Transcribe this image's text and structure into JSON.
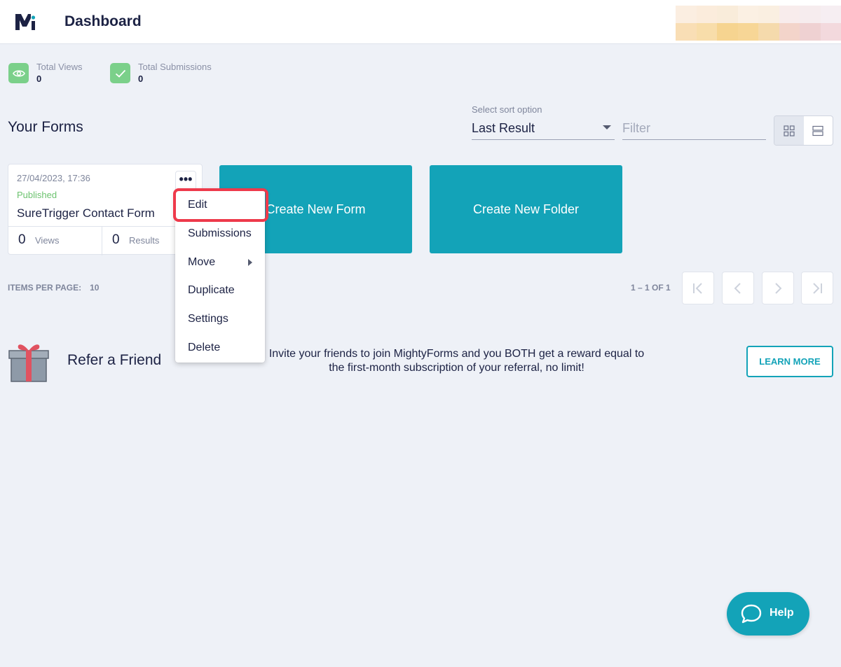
{
  "header": {
    "title": "Dashboard",
    "logo_icon": "mightyforms-logo"
  },
  "stats": [
    {
      "label": "Total Views",
      "value": "0",
      "icon": "eye-icon"
    },
    {
      "label": "Total Submissions",
      "value": "0",
      "icon": "check-icon"
    }
  ],
  "forms_section": {
    "title": "Your Forms",
    "sort": {
      "caption": "Select sort option",
      "selected": "Last Result"
    },
    "filter": {
      "placeholder": "Filter",
      "value": ""
    },
    "view_modes": [
      "grid-view-icon",
      "list-view-icon"
    ],
    "active_view": "grid"
  },
  "form_card": {
    "date": "27/04/2023, 17:36",
    "status": "Published",
    "name": "SureTrigger Contact Form",
    "views_count": "0",
    "views_label": "Views",
    "results_count": "0",
    "results_label": "Results",
    "more_label": "•••"
  },
  "create_form_label": "Create New Form",
  "create_folder_label": "Create New Folder",
  "pagination": {
    "items_per_page_label": "ITEMS PER PAGE:",
    "items_per_page": "10",
    "range": "1 – 1 OF 1"
  },
  "refer": {
    "title": "Refer a Friend",
    "text": "Invite your friends to join MightyForms and you BOTH get a reward equal to the first-month subscription of your referral, no limit!",
    "button": "LEARN MORE"
  },
  "context_menu": {
    "items": [
      "Edit",
      "Submissions",
      "Move",
      "Duplicate",
      "Settings",
      "Delete"
    ],
    "highlighted": "Edit"
  },
  "help_label": "Help",
  "colors": {
    "accent": "#13a3b8",
    "published": "#6cc36f",
    "stat_icon_bg": "#7bd08a",
    "highlight": "#ee3a4b",
    "background": "#eef1f7"
  }
}
